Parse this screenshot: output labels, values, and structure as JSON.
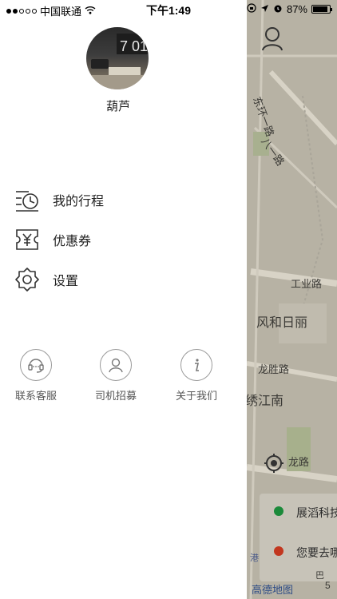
{
  "status_bar": {
    "carrier": "中国联通",
    "time": "下午1:49",
    "battery": "87%"
  },
  "drawer": {
    "username": "葫芦",
    "menu": [
      {
        "label": "我的行程",
        "icon": "trip-history-icon"
      },
      {
        "label": "优惠券",
        "icon": "coupon-icon"
      },
      {
        "label": "设置",
        "icon": "settings-icon"
      }
    ],
    "shortcuts": [
      {
        "label": "联系客服",
        "icon": "customer-service-icon"
      },
      {
        "label": "司机招募",
        "icon": "driver-recruit-icon"
      },
      {
        "label": "关于我们",
        "icon": "info-icon"
      }
    ]
  },
  "map": {
    "labels": [
      "东环一路",
      "八一路",
      "工业路",
      "风和日丽",
      "龙胜路",
      "绣江南",
      "龙路",
      "巴"
    ],
    "start_text": "展滔科技",
    "destination_text": "您要去哪",
    "watermark": "高德地图",
    "poi_text": "港",
    "scale_text": "5"
  },
  "colors": {
    "map_base": "#b7b2a4",
    "start_dot": "#1b8a3a",
    "end_dot": "#c2371f"
  }
}
